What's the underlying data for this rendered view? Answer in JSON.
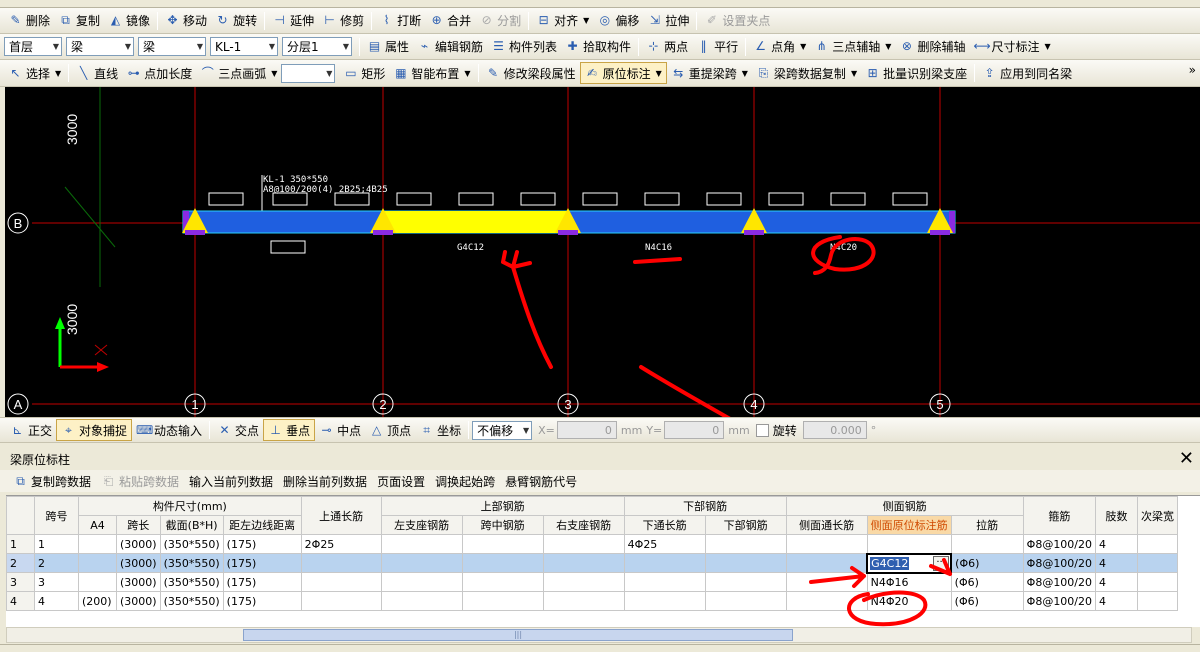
{
  "toolbar1": {
    "items": [
      {
        "label": "删除",
        "icon": "eraser-icon"
      },
      {
        "label": "复制",
        "icon": "copy-icon"
      },
      {
        "label": "镜像",
        "icon": "mirror-icon"
      },
      {
        "label": "移动",
        "icon": "move-icon"
      },
      {
        "label": "旋转",
        "icon": "rotate-icon"
      },
      {
        "label": "延伸",
        "icon": "extend-icon"
      },
      {
        "label": "修剪",
        "icon": "trim-icon"
      },
      {
        "label": "打断",
        "icon": "break-icon"
      },
      {
        "label": "合并",
        "icon": "merge-icon"
      },
      {
        "label": "分割",
        "icon": "split-icon",
        "disabled": true
      },
      {
        "label": "对齐",
        "icon": "align-icon",
        "dropdown": true
      },
      {
        "label": "偏移",
        "icon": "offset-icon"
      },
      {
        "label": "拉伸",
        "icon": "stretch-icon"
      },
      {
        "label": "设置夹点",
        "icon": "grip-icon",
        "disabled": true
      }
    ]
  },
  "toolbar2": {
    "floor": "首层",
    "category": "梁",
    "type": "梁",
    "component": "KL-1",
    "layer": "分层1",
    "items": [
      {
        "label": "属性",
        "icon": "property-icon"
      },
      {
        "label": "编辑钢筋",
        "icon": "edit-rebar-icon"
      },
      {
        "label": "构件列表",
        "icon": "list-icon"
      },
      {
        "label": "拾取构件",
        "icon": "pick-icon"
      },
      {
        "label": "两点",
        "icon": "two-point-icon"
      },
      {
        "label": "平行",
        "icon": "parallel-icon"
      },
      {
        "label": "点角",
        "icon": "point-angle-icon",
        "dropdown": true
      },
      {
        "label": "三点辅轴",
        "icon": "three-point-axis-icon",
        "dropdown": true
      },
      {
        "label": "删除辅轴",
        "icon": "delete-axis-icon"
      },
      {
        "label": "尺寸标注",
        "icon": "dimension-icon",
        "dropdown": true
      }
    ]
  },
  "toolbar3": {
    "select_label": "选择",
    "items": [
      {
        "label": "直线",
        "icon": "line-icon"
      },
      {
        "label": "点加长度",
        "icon": "point-length-icon"
      },
      {
        "label": "三点画弧",
        "icon": "arc-icon",
        "dropdown": true
      }
    ],
    "items2": [
      {
        "label": "矩形",
        "icon": "rect-icon"
      },
      {
        "label": "智能布置",
        "icon": "smart-layout-icon",
        "dropdown": true
      },
      {
        "label": "修改梁段属性",
        "icon": "modify-beam-icon"
      },
      {
        "label": "原位标注",
        "icon": "in-situ-mark-icon",
        "dropdown": true,
        "active": true
      },
      {
        "label": "重提梁跨",
        "icon": "re-span-icon",
        "dropdown": true
      },
      {
        "label": "梁跨数据复制",
        "icon": "span-copy-icon",
        "dropdown": true
      },
      {
        "label": "批量识别梁支座",
        "icon": "batch-support-icon"
      },
      {
        "label": "应用到同名梁",
        "icon": "apply-same-icon"
      }
    ],
    "overflow": "»"
  },
  "canvas": {
    "dim_top": "3000",
    "dim_bottom": "3000",
    "axis_row_b": "B",
    "axis_row_a": "A",
    "axis_cols": [
      "1",
      "2",
      "3",
      "4",
      "5"
    ],
    "beam_label_line1": "KL-1 350*550",
    "beam_label_line2": "A8@100/200(4) 2B25;4B25",
    "side_rebar_labels": [
      "G4C12",
      "N4C16",
      "N4C20"
    ],
    "colors": {
      "background": "#000000",
      "beam": "#1f5fe0",
      "beam_edge": "#2ad1ff",
      "selected_span": "#ffff00",
      "support": "#ffe600",
      "axis_line": "#c00000",
      "axis_bubble": "#ffffff",
      "annotation": "#ff0000",
      "ucs_y": "#00ff00",
      "ucs_x": "#ff0000"
    }
  },
  "snapbar": {
    "items": [
      {
        "label": "正交",
        "icon": "ortho-icon"
      },
      {
        "label": "对象捕捉",
        "icon": "object-snap-icon",
        "active": true
      },
      {
        "label": "动态输入",
        "icon": "dynamic-input-icon"
      }
    ],
    "snaps": [
      {
        "label": "交点",
        "icon": "intersection-icon"
      },
      {
        "label": "垂点",
        "icon": "perpendicular-icon",
        "active": true
      },
      {
        "label": "中点",
        "icon": "midpoint-icon"
      },
      {
        "label": "顶点",
        "icon": "vertex-icon"
      },
      {
        "label": "坐标",
        "icon": "coordinate-icon"
      }
    ],
    "offset_mode": "不偏移",
    "x_label": "X=",
    "x_value": "0",
    "y_label": "Y=",
    "y_value": "0",
    "unit": "mm",
    "rotate_label": "旋转",
    "rotate_value": "0.000",
    "degree": "°"
  },
  "panel": {
    "title": "梁原位标柱",
    "close": "✕",
    "actions": [
      {
        "label": "复制跨数据",
        "icon": "copy-span-icon"
      },
      {
        "label": "粘贴跨数据",
        "icon": "paste-span-icon",
        "disabled": true
      },
      {
        "label": "输入当前列数据"
      },
      {
        "label": "删除当前列数据"
      },
      {
        "label": "页面设置"
      },
      {
        "label": "调换起始跨"
      },
      {
        "label": "悬臂钢筋代号"
      }
    ]
  },
  "grid": {
    "group_headers": {
      "span_no": "跨号",
      "size": "构件尺寸(mm)",
      "top_through": "上通长筋",
      "top": "上部钢筋",
      "bottom": "下部钢筋",
      "side": "侧面钢筋",
      "stirrup": "箍筋",
      "legs": "肢数",
      "secondary": "次梁宽"
    },
    "sub_headers": {
      "a4": "A4",
      "span_len": "跨长",
      "section": "截面(B*H)",
      "axis_dist": "距左边线距离",
      "left_support": "左支座钢筋",
      "mid_span": "跨中钢筋",
      "right_support": "右支座钢筋",
      "bottom_through": "下通长筋",
      "bottom_rebar": "下部钢筋",
      "side_through": "侧面通长筋",
      "side_in_situ": "侧面原位标注筋",
      "tie": "拉筋"
    },
    "edit_button": "···",
    "rows": [
      {
        "idx": "1",
        "span": "1",
        "a4": "",
        "len": "(3000)",
        "sec": "(350*550)",
        "dist": "(175)",
        "top": "2Φ25",
        "left": "",
        "mid": "",
        "right": "",
        "btm_through": "4Φ25",
        "btm": "",
        "side_through": "",
        "side_mark": "",
        "tie": "",
        "stirrup": "Φ8@100/20",
        "legs": "4",
        "sec_w": ""
      },
      {
        "idx": "2",
        "span": "2",
        "a4": "",
        "len": "(3000)",
        "sec": "(350*550)",
        "dist": "(175)",
        "top": "",
        "left": "",
        "mid": "",
        "right": "",
        "btm_through": "",
        "btm": "",
        "side_through": "",
        "side_mark": "G4C12",
        "tie": "(Φ6)",
        "stirrup": "Φ8@100/20",
        "legs": "4",
        "sec_w": "",
        "selected": true
      },
      {
        "idx": "3",
        "span": "3",
        "a4": "",
        "len": "(3000)",
        "sec": "(350*550)",
        "dist": "(175)",
        "top": "",
        "left": "",
        "mid": "",
        "right": "",
        "btm_through": "",
        "btm": "",
        "side_through": "",
        "side_mark": "N4Φ16",
        "tie": "(Φ6)",
        "stirrup": "Φ8@100/20",
        "legs": "4",
        "sec_w": ""
      },
      {
        "idx": "4",
        "span": "4",
        "a4": "(200)",
        "len": "(3000)",
        "sec": "(350*550)",
        "dist": "(175)",
        "top": "",
        "left": "",
        "mid": "",
        "right": "",
        "btm_through": "",
        "btm": "",
        "side_through": "",
        "side_mark": "N4Φ20",
        "tie": "(Φ6)",
        "stirrup": "Φ8@100/20",
        "legs": "4",
        "sec_w": ""
      }
    ]
  }
}
